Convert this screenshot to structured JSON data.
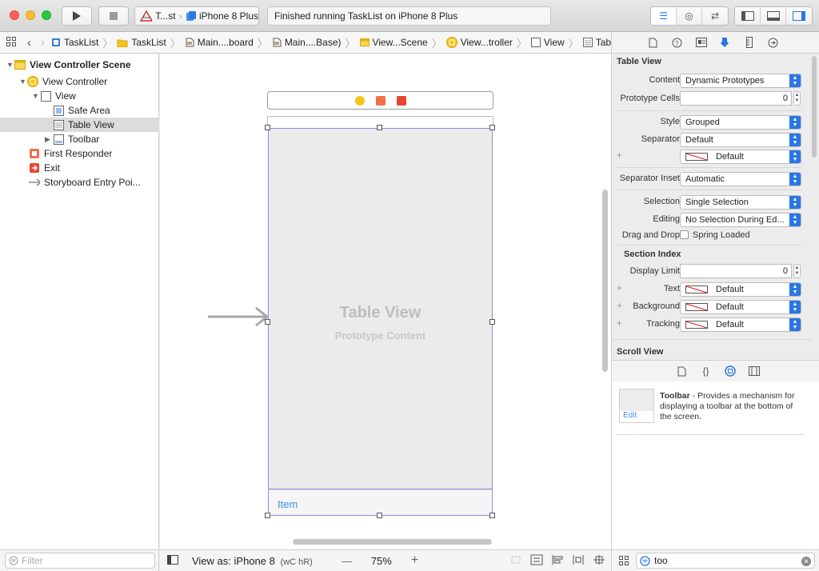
{
  "toolbar": {
    "scheme_name": "T...st",
    "device_name": "iPhone 8 Plus",
    "activity_status": "Finished running TaskList on iPhone 8 Plus"
  },
  "jumpbar": {
    "crumbs": [
      "TaskList",
      "TaskList",
      "Main....board",
      "Main....Base)",
      "View...Scene",
      "View...troller",
      "View",
      "Table View"
    ]
  },
  "navigator": {
    "items": [
      {
        "label": "View Controller Scene"
      },
      {
        "label": "View Controller"
      },
      {
        "label": "View"
      },
      {
        "label": "Safe Area"
      },
      {
        "label": "Table View"
      },
      {
        "label": "Toolbar"
      },
      {
        "label": "First Responder"
      },
      {
        "label": "Exit"
      },
      {
        "label": "Storyboard Entry Poi..."
      }
    ],
    "filter_placeholder": "Filter"
  },
  "canvas": {
    "table_view_title": "Table View",
    "table_view_subtitle": "Prototype Content",
    "toolbar_item": "Item",
    "footer": {
      "view_as": "View as: iPhone 8",
      "size_class": "(wC hR)",
      "zoom_minus": "—",
      "zoom_level": "75%",
      "zoom_plus": "+"
    }
  },
  "inspector": {
    "table_view_section": "Table View",
    "content_label": "Content",
    "content_value": "Dynamic Prototypes",
    "prototype_cells_label": "Prototype Cells",
    "prototype_cells_value": "0",
    "style_label": "Style",
    "style_value": "Grouped",
    "separator_label": "Separator",
    "separator_value": "Default",
    "separator_color_value": "Default",
    "separator_inset_label": "Separator Inset",
    "separator_inset_value": "Automatic",
    "selection_label": "Selection",
    "selection_value": "Single Selection",
    "editing_label": "Editing",
    "editing_value": "No Selection During Ed...",
    "drag_drop_label": "Drag and Drop",
    "spring_loaded_label": "Spring Loaded",
    "section_index_title": "Section Index",
    "display_limit_label": "Display Limit",
    "display_limit_value": "0",
    "text_label": "Text",
    "text_value": "Default",
    "background_label": "Background",
    "background_value": "Default",
    "tracking_label": "Tracking",
    "tracking_value": "Default",
    "scroll_view_section": "Scroll View"
  },
  "library": {
    "item_title": "Toolbar",
    "item_description": " - Provides a mechanism for displaying a toolbar at the bottom of the screen.",
    "edit_label": "Edit",
    "search_value": "too"
  },
  "colors": {
    "accent": "#2a76e6",
    "selection_border": "#8e8ed6"
  }
}
